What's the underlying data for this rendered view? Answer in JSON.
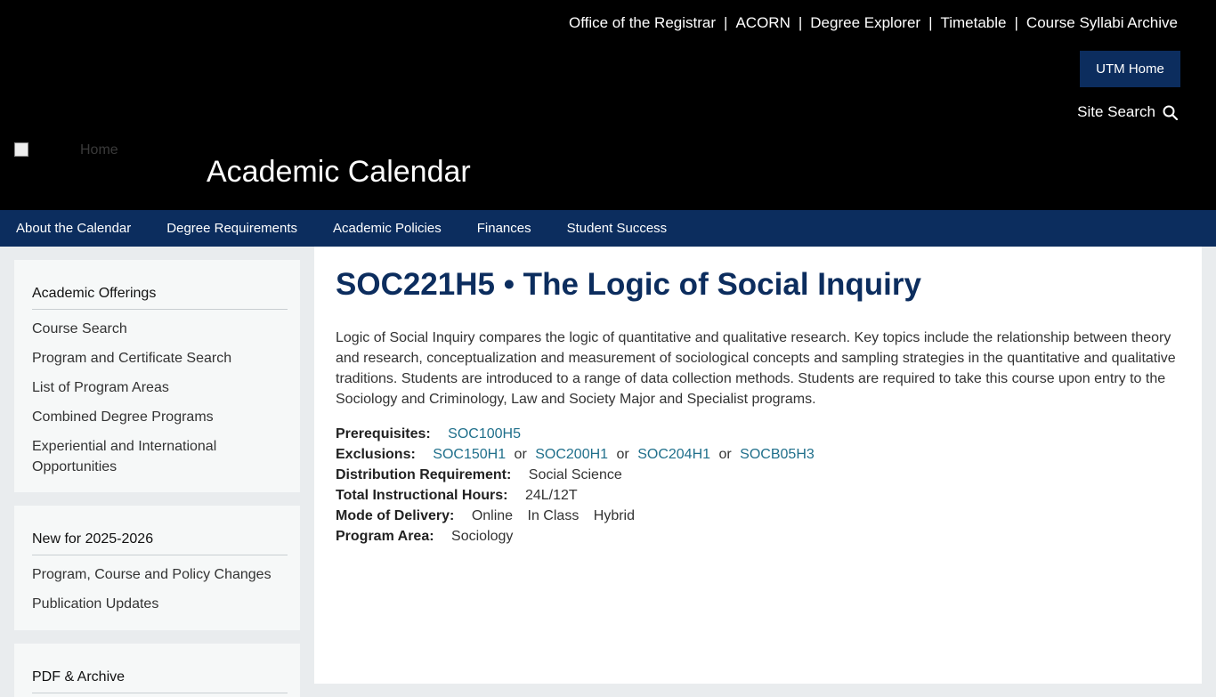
{
  "header": {
    "top_links": [
      "Office of the Registrar",
      "ACORN",
      "Degree Explorer",
      "Timetable",
      "Course Syllabi Archive"
    ],
    "separator": "|",
    "utm_home": "UTM Home",
    "site_search": "Site Search",
    "logo_alt": "Home",
    "title": "Academic Calendar"
  },
  "nav": [
    "About the Calendar",
    "Degree Requirements",
    "Academic Policies",
    "Finances",
    "Student Success"
  ],
  "sidebar": {
    "box1": {
      "title": "Academic Offerings",
      "items": [
        "Course Search",
        "Program and Certificate Search",
        "List of Program Areas",
        "Combined Degree Programs",
        "Experiential and International Opportunities"
      ]
    },
    "box2": {
      "title": "New for 2025-2026",
      "items": [
        "Program, Course and Policy Changes",
        "Publication Updates"
      ]
    },
    "box3": {
      "title": "PDF & Archive"
    }
  },
  "course": {
    "title": "SOC221H5 • The Logic of Social Inquiry",
    "description": "Logic of Social Inquiry compares the logic of quantitative and qualitative research. Key topics include the relationship between theory and research, conceptualization and measurement of sociological concepts and sampling strategies in the quantitative and qualitative traditions. Students are introduced to a range of data collection methods. Students are required to take this course upon entry to the Sociology and Criminology, Law and Society Major and Specialist programs.",
    "prerequisites_label": "Prerequisites:",
    "prerequisites": "SOC100H5",
    "exclusions_label": "Exclusions:",
    "exclusions": [
      "SOC150H1",
      "SOC200H1",
      "SOC204H1",
      "SOCB05H3"
    ],
    "or": "or",
    "distribution_label": "Distribution Requirement:",
    "distribution": "Social Science",
    "hours_label": "Total Instructional Hours:",
    "hours": "24L/12T",
    "mode_label": "Mode of Delivery:",
    "modes": [
      "Online",
      "In Class",
      "Hybrid"
    ],
    "program_area_label": "Program Area:",
    "program_area": "Sociology"
  },
  "colors": {
    "header_bg": "#000000",
    "nav_bg": "#0c2d5e",
    "title_color": "#0c2d5e",
    "link_color": "#1f6f8b"
  }
}
